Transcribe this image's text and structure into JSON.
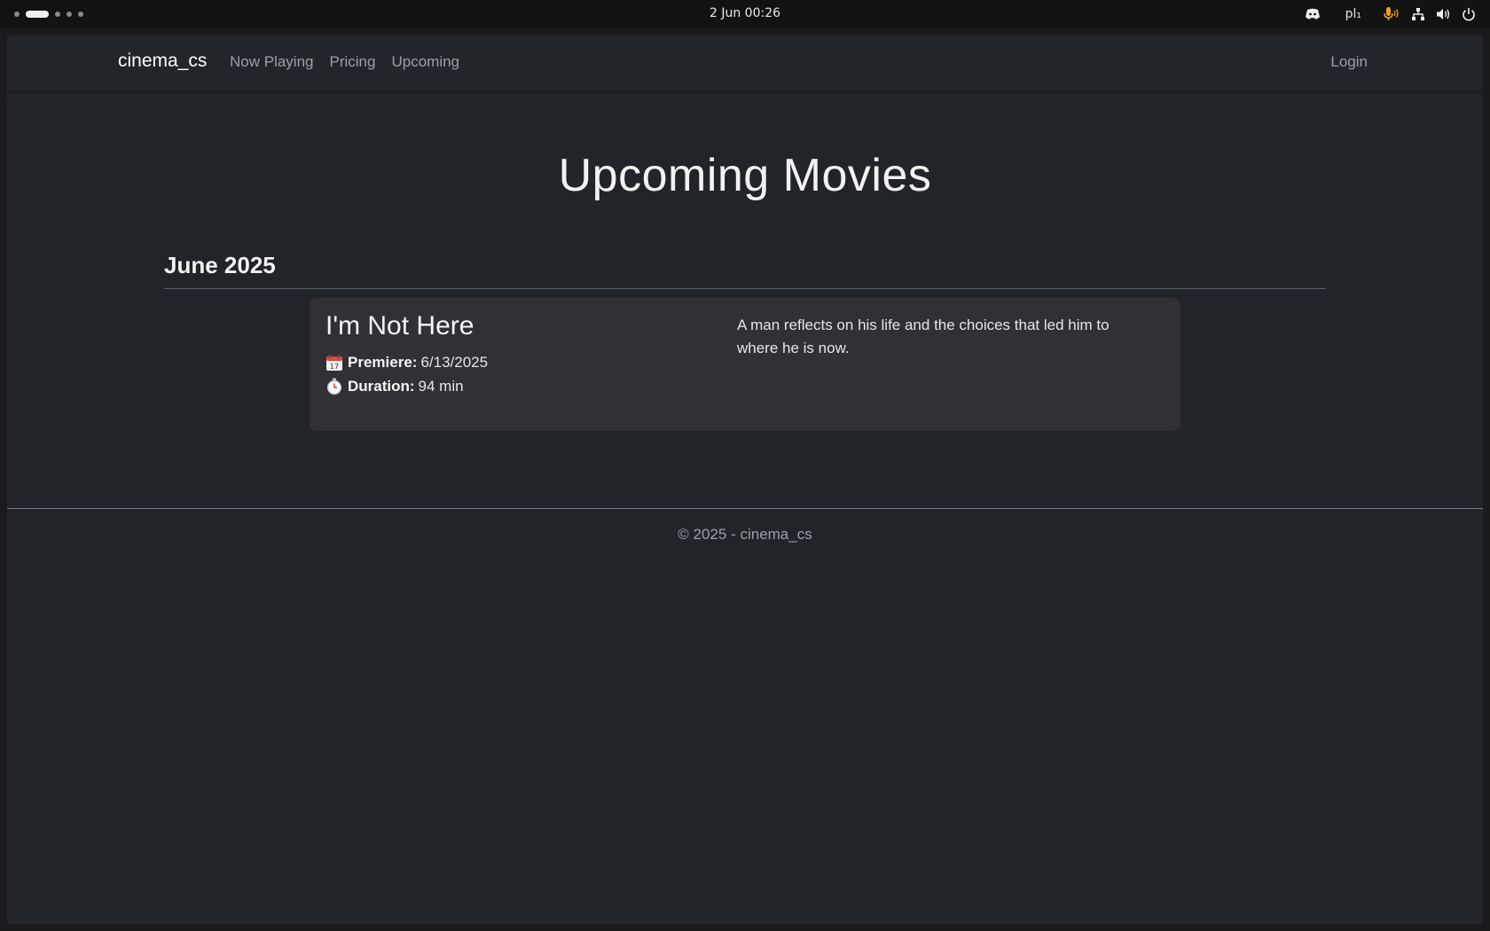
{
  "os_bar": {
    "clock": "2 Jun  00:26",
    "keyboard_layout": "pl₁",
    "tray_icons": [
      "discord-icon",
      "microphone-icon",
      "network-icon",
      "volume-icon",
      "power-icon"
    ],
    "accent_mic_color": "#f0a020"
  },
  "navbar": {
    "brand": "cinema_cs",
    "links": [
      {
        "label": "Now Playing"
      },
      {
        "label": "Pricing"
      },
      {
        "label": "Upcoming"
      }
    ],
    "login_label": "Login"
  },
  "main": {
    "title": "Upcoming Movies",
    "groups": [
      {
        "month": "June 2025",
        "movies": [
          {
            "title": "I'm Not Here",
            "premiere_label": "Premiere:",
            "premiere_value": "6/13/2025",
            "duration_label": "Duration:",
            "duration_value": "94 min",
            "description": "A man reflects on his life and the choices that led him to where he is now."
          }
        ]
      }
    ]
  },
  "footer": {
    "text": "© 2025 - cinema_cs"
  },
  "colors": {
    "background": "#212529",
    "card": "#313035",
    "link": "#9aa0a6",
    "text": "#f2f2f2"
  }
}
